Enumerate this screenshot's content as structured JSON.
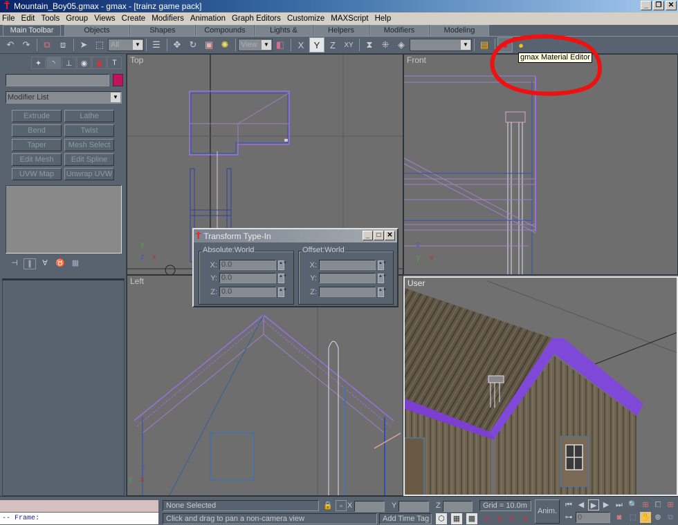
{
  "window": {
    "title": "Mountain_Boy05.gmax - gmax - [trainz game pack]",
    "controls": [
      "minimize",
      "restore",
      "close"
    ]
  },
  "menu": [
    "File",
    "Edit",
    "Tools",
    "Group",
    "Views",
    "Create",
    "Modifiers",
    "Animation",
    "Graph Editors",
    "Customize",
    "MAXScript",
    "Help"
  ],
  "tabs": [
    {
      "label": "Main Toolbar",
      "active": true
    },
    {
      "label": "Objects"
    },
    {
      "label": "Shapes"
    },
    {
      "label": "Compounds"
    },
    {
      "label": "Lights & Cameras"
    },
    {
      "label": "Helpers"
    },
    {
      "label": "Modifiers"
    },
    {
      "label": "Modeling"
    }
  ],
  "toolbar": {
    "selection_filter": "All",
    "reference_coord": "View",
    "named_selection": "",
    "axis_constraints": [
      "X",
      "Y",
      "Z",
      "XY"
    ],
    "active_axis": "Y",
    "tooltip": "gmax Material Editor",
    "annotation_color": "#ee1111"
  },
  "command_panel": {
    "object_name": "",
    "object_color": "#c0145a",
    "modifier_list": "Modifier List",
    "modifier_buttons": [
      "Extrude",
      "Lathe",
      "Bend",
      "Twist",
      "Taper",
      "Mesh Select",
      "Edit Mesh",
      "Edit Spline",
      "UVW Map",
      "Unwrap UVW"
    ]
  },
  "viewports": {
    "top": "Top",
    "front": "Front",
    "left": "Left",
    "user": "User"
  },
  "transform_dialog": {
    "title": "Transform Type-In",
    "absolute_label": "Absolute:World",
    "offset_label": "Offset:World",
    "absolute": {
      "x": "0.0",
      "y": "0.0",
      "z": "0.0"
    },
    "offset": {
      "x": "",
      "y": "",
      "z": ""
    },
    "axis_labels": {
      "x": "X:",
      "y": "Y:",
      "z": "Z:"
    }
  },
  "status": {
    "listener_line": "--  Frame:",
    "selection": "None Selected",
    "prompt": "Click and drag to pan a non-camera view",
    "coord_labels": {
      "x": "X",
      "y": "Y",
      "z": "Z"
    },
    "grid": "Grid = 10.0m",
    "add_time_tag": "Add Time Tag",
    "anim": "Anim.",
    "frame": "0"
  }
}
